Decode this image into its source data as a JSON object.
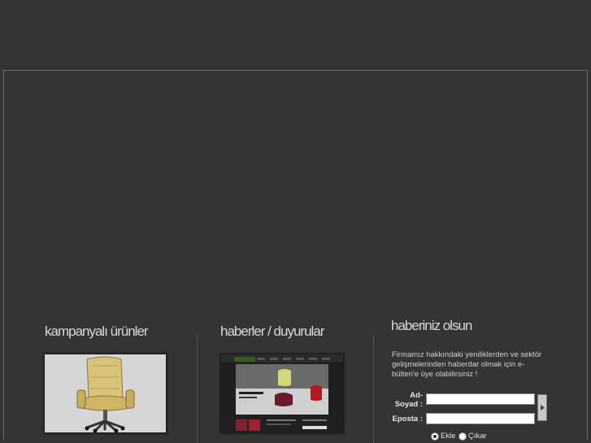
{
  "sections": {
    "campaign": {
      "title": "kampanyalı ürünler"
    },
    "news": {
      "title": "haberler / duyurular"
    },
    "newsletter": {
      "title": "haberiniz olsun",
      "description": "Firmamız hakkındaki yeniliklerden ve sektör gelişmelerinden haberdar olmak için e-bülten'e üye olabilirsiniz !",
      "name_label_1": "Ad-",
      "name_label_2": "Soyad :",
      "email_label": "Eposta :",
      "name_value": "",
      "email_value": "",
      "option_add": "Ekle",
      "option_remove": "Çıkar",
      "selected_option": "Ekle"
    }
  },
  "colors": {
    "background": "#333333",
    "border": "#6a6a6a",
    "text": "#cccccc"
  },
  "icons": {
    "submit": "arrow-right-icon"
  }
}
